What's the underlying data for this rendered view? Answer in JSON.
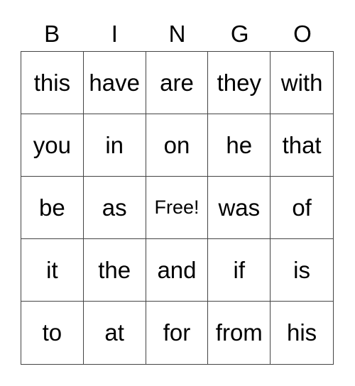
{
  "header": [
    "B",
    "I",
    "N",
    "G",
    "O"
  ],
  "rows": [
    [
      "this",
      "have",
      "are",
      "they",
      "with"
    ],
    [
      "you",
      "in",
      "on",
      "he",
      "that"
    ],
    [
      "be",
      "as",
      "Free!",
      "was",
      "of"
    ],
    [
      "it",
      "the",
      "and",
      "if",
      "is"
    ],
    [
      "to",
      "at",
      "for",
      "from",
      "his"
    ]
  ]
}
